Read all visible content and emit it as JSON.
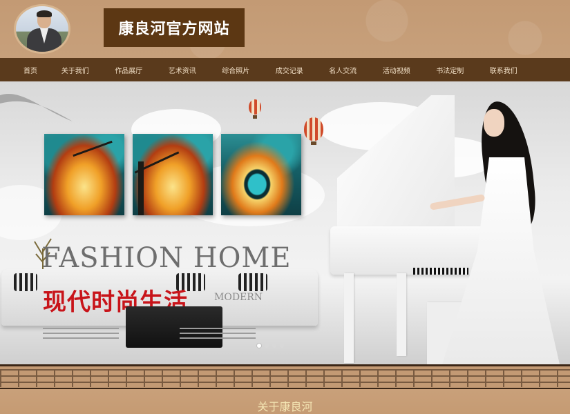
{
  "header": {
    "site_title": "康良河官方网站"
  },
  "nav": {
    "items": [
      "首页",
      "关于我们",
      "作品展厅",
      "艺术资讯",
      "综合照片",
      "成交记录",
      "名人交流",
      "活动视频",
      "书法定制",
      "联系我们"
    ]
  },
  "banner": {
    "headline_en": "FASHION HOME",
    "slogan": "现代时尚生活",
    "sub_label": "MODERN",
    "slide_count": 4,
    "active_slide": 1
  },
  "about": {
    "title": "关于康良河"
  },
  "colors": {
    "nav_bg": "#5a3a1c",
    "title_bg": "#5c3713",
    "page_bg": "#c9a07a",
    "slogan_red": "#c8141a"
  }
}
